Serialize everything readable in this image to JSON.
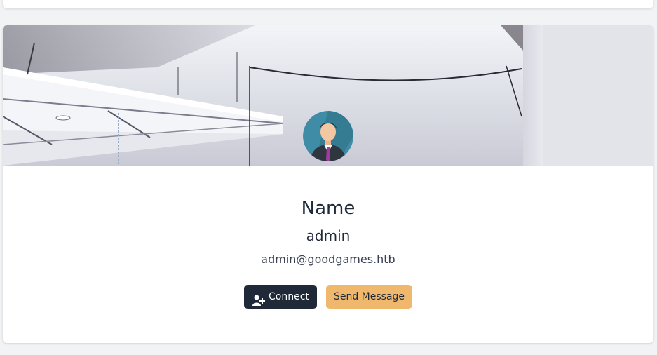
{
  "profile": {
    "title": "Name",
    "username": "admin",
    "email": "admin@goodgames.htb"
  },
  "actions": {
    "connect_label": "Connect",
    "connect_icon": "user-plus-icon",
    "message_label": "Send Message"
  },
  "colors": {
    "page_background": "#f2f3f5",
    "card_background": "#ffffff",
    "connect_button": "#1f2937",
    "message_button": "#f0b86c",
    "avatar_background": "#3f8ca6"
  }
}
